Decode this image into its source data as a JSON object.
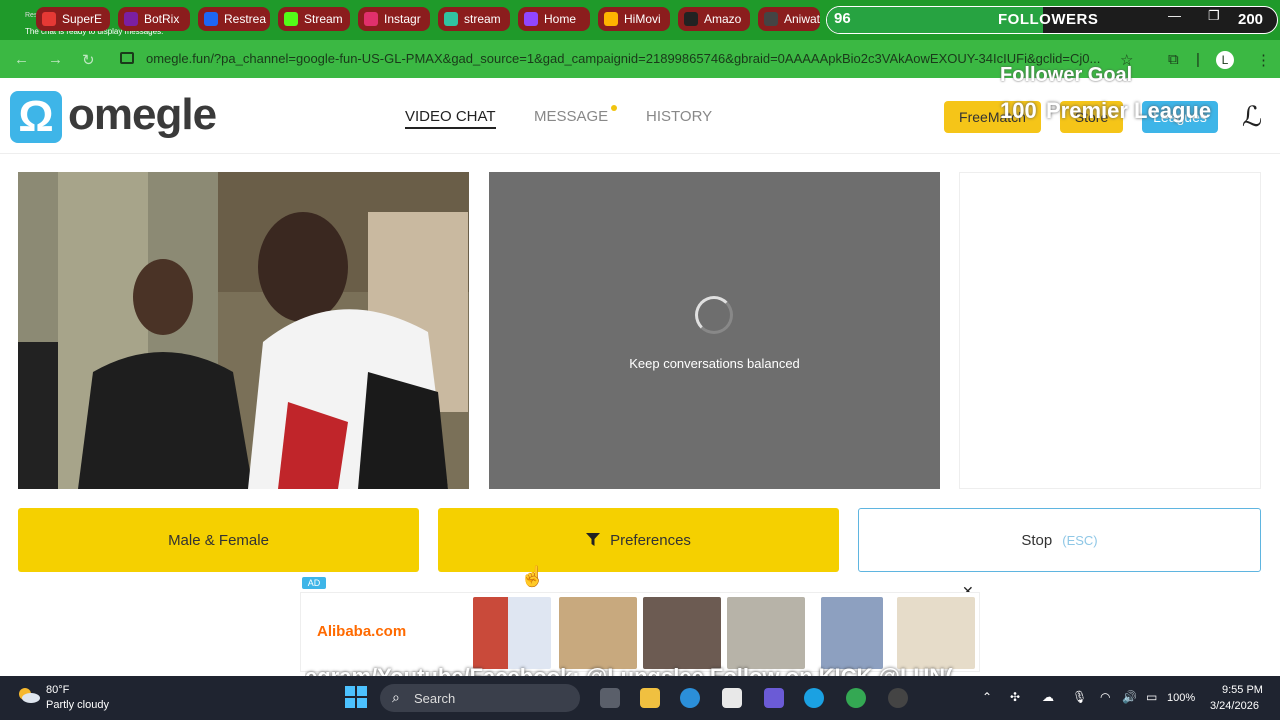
{
  "browser": {
    "tabs": [
      {
        "label": "SuperE",
        "icon": "youtube-icon",
        "color": "#e53935"
      },
      {
        "label": "BotRix",
        "icon": "botrix-icon",
        "color": "#7b1fa2"
      },
      {
        "label": "Restrea",
        "icon": "restream-icon",
        "color": "#1e66f5"
      },
      {
        "label": "Stream",
        "icon": "kick-icon",
        "color": "#53fc18"
      },
      {
        "label": "Instagr",
        "icon": "instagram-icon",
        "color": "#e1306c"
      },
      {
        "label": "stream",
        "icon": "streamlabs-icon",
        "color": "#31c3a2"
      },
      {
        "label": "Home",
        "icon": "twitch-icon",
        "color": "#9146ff"
      },
      {
        "label": "HiMovi",
        "icon": "play-icon",
        "color": "#ffb300"
      },
      {
        "label": "Amazo",
        "icon": "amazon-icon",
        "color": "#222222"
      },
      {
        "label": "Aniwat",
        "icon": "aniwatch-icon",
        "color": "#444444"
      }
    ],
    "overlay_small_text": "Restream",
    "chat_ready": "The chat is ready to display messages.",
    "url": "omegle.fun/?pa_channel=google-fun-US-GL-PMAX&gad_source=1&gad_campaignid=21899865746&gbraid=0AAAAApkBio2c3VAkAowEXOUY-34IcIUFi&gclid=Cj0...",
    "profile_letter": "L"
  },
  "followers": {
    "current": "96",
    "label": "FOLLOWERS",
    "goal": "200",
    "progress": 0.48,
    "goal_title": "Follower Goal",
    "goal_count": "100",
    "league_label": "Premier League"
  },
  "site": {
    "logo": "omegle",
    "nav": {
      "video_chat": "VIDEO CHAT",
      "message": "MESSAGE",
      "history": "HISTORY"
    },
    "header_buttons": {
      "freematch": "FreeMatch",
      "store": "Store",
      "leagues": "Leagues"
    }
  },
  "video": {
    "remote_status": "Keep conversations balanced"
  },
  "controls": {
    "gender": "Male & Female",
    "preferences": "Preferences",
    "stop": "Stop",
    "stop_hint": "(ESC)"
  },
  "ad": {
    "badge": "AD",
    "brand": "Alibaba.com"
  },
  "ticker": "egram/Youtube/Facebook: @Lungslee Follow on KICK @LUN(",
  "taskbar": {
    "temp": "80°F",
    "weather": "Partly cloudy",
    "search": "Search",
    "battery": "100%",
    "time": "9:55 PM",
    "date": "3/24/2026"
  }
}
